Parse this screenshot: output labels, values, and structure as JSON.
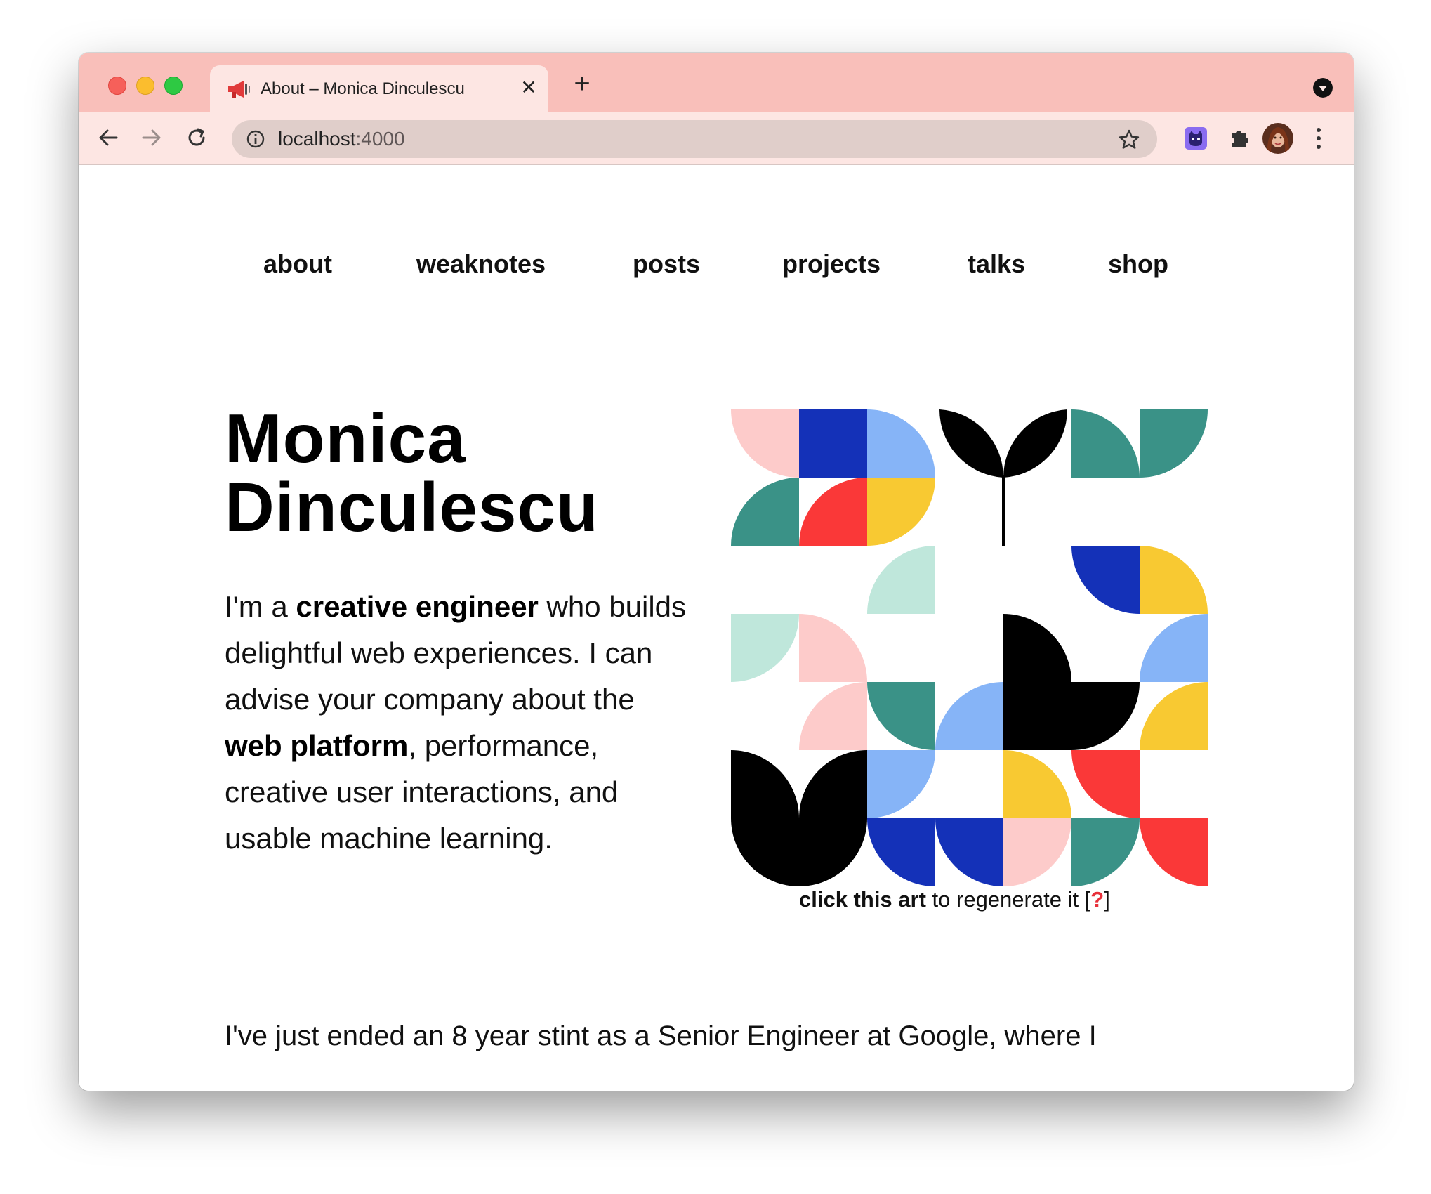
{
  "browser": {
    "tab_title": "About – Monica Dinculescu",
    "url_host": "localhost",
    "url_port": ":4000"
  },
  "nav": {
    "items": [
      "about",
      "weaknotes",
      "posts",
      "projects",
      "talks",
      "shop"
    ]
  },
  "hero": {
    "name_line1": "Monica",
    "name_line2": "Dinculescu",
    "bio_1": "I'm a ",
    "bio_2": "creative engineer",
    "bio_3": " who builds delightful web experiences. I can advise your company about the ",
    "bio_4": "web platform",
    "bio_5": ", performance, creative user interactions, and usable machine learning."
  },
  "art": {
    "caption_bold": "click this art",
    "caption_rest": " to regenerate it [",
    "caption_q": "?",
    "caption_end": "]",
    "palette": {
      "pink": "#fdcbca",
      "navy": "#1431b8",
      "light_blue": "#86b4f7",
      "teal": "#3a9287",
      "red": "#fa3838",
      "yellow": "#f8c932",
      "mint": "#bfe7db",
      "black": "#000000"
    }
  },
  "body_text": {
    "para_1": "I've just ended an 8 year stint as a Senior Engineer at Google, where I"
  },
  "icons": {
    "back": "back-arrow-icon",
    "forward": "forward-arrow-icon",
    "reload": "reload-icon",
    "info": "info-icon",
    "star": "bookmark-star-icon",
    "extension_1": "cat-extension-icon",
    "extension_2": "puzzle-extensions-icon",
    "profile": "profile-avatar",
    "menu": "kebab-menu-icon"
  }
}
